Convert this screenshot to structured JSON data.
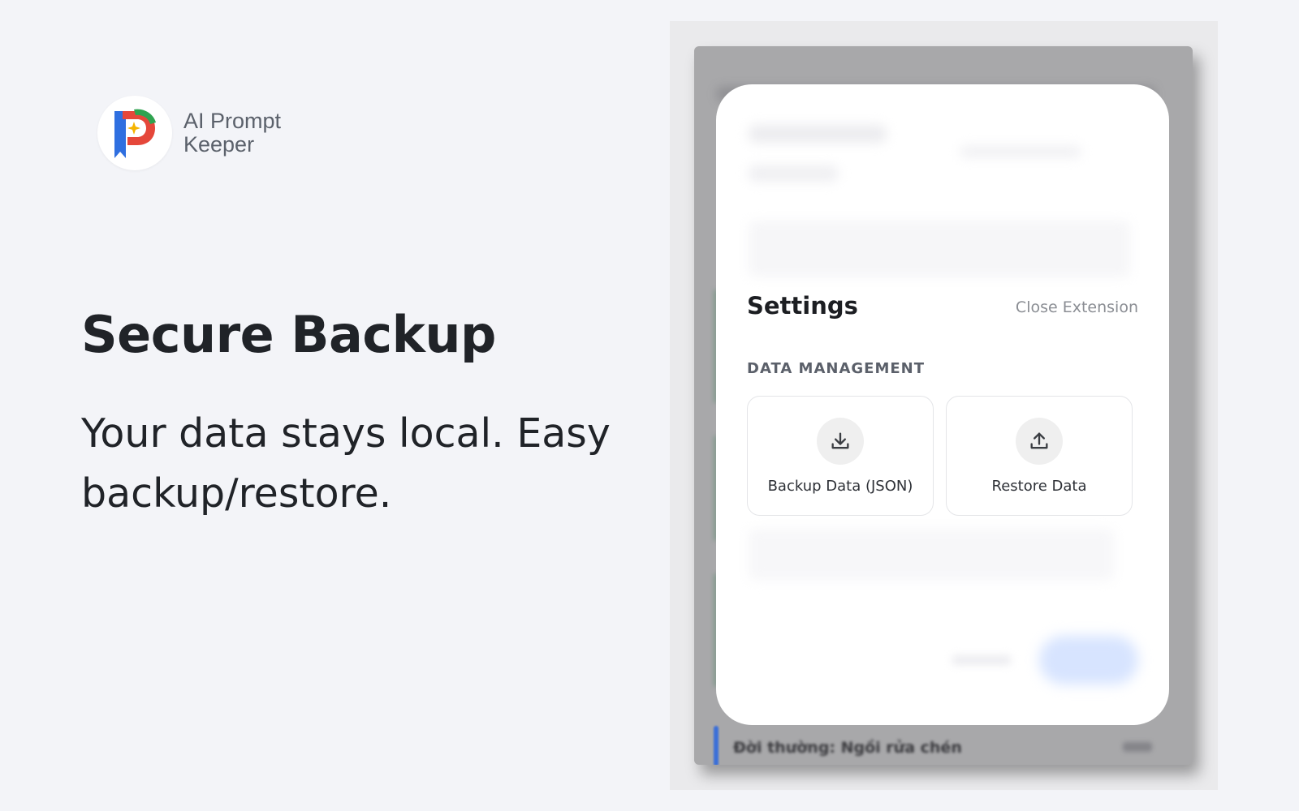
{
  "brand": {
    "name_line1": "AI Prompt",
    "name_line2": "Keeper",
    "logo_icon": "ai-prompt-keeper-logo"
  },
  "hero": {
    "title": "Secure Backup",
    "subtitle": "Your data stays local. Easy backup/restore."
  },
  "extension": {
    "settings": {
      "title": "Settings",
      "close_label": "Close Extension",
      "section_label": "DATA MANAGEMENT",
      "actions": [
        {
          "label": "Backup Data (JSON)",
          "icon": "download-icon"
        },
        {
          "label": "Restore Data",
          "icon": "upload-icon"
        }
      ]
    },
    "background_row_text": "Đời thường: Ngồi rửa chén"
  },
  "colors": {
    "page_bg": "#f3f4f8",
    "headline": "#202328",
    "brand_text": "#5b616b",
    "modal_bg": "#ffffff",
    "muted_text": "#8a8d93",
    "accent_blue": "#3b6fd8"
  }
}
